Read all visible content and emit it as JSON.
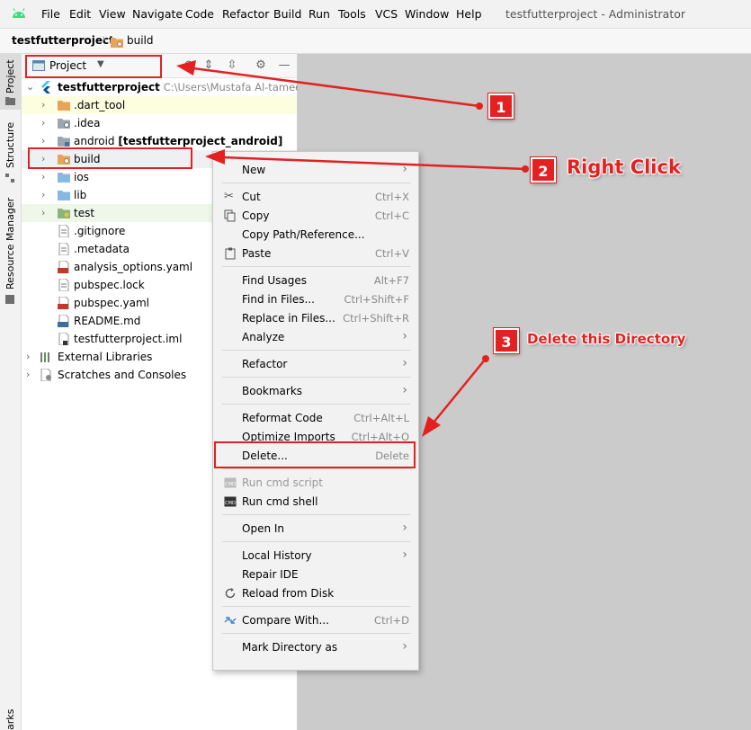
{
  "menubar": {
    "items": [
      "File",
      "Edit",
      "View",
      "Navigate",
      "Code",
      "Refactor",
      "Build",
      "Run",
      "Tools",
      "VCS",
      "Window",
      "Help"
    ],
    "window_title": "testfutterproject - Administrator"
  },
  "breadcrumb": {
    "project": "testfutterproject",
    "folder": "build"
  },
  "left_tabs": {
    "project": "Project",
    "structure": "Structure",
    "resource_manager": "Resource Manager",
    "bookmarks": "arks"
  },
  "panel": {
    "view_selector": "Project"
  },
  "tree": {
    "root": {
      "name": "testfutterproject",
      "path": "C:\\Users\\Mustafa Al-tameemi\\"
    },
    "items": [
      {
        "name": ".dart_tool",
        "icon": "folder-orange-icon"
      },
      {
        "name": ".idea",
        "icon": "folder-gear-icon"
      },
      {
        "name": "android",
        "suffix": "[testfutterproject_android]",
        "icon": "folder-module-icon"
      },
      {
        "name": "build",
        "icon": "folder-build-icon"
      },
      {
        "name": "ios",
        "icon": "folder-blue-icon"
      },
      {
        "name": "lib",
        "icon": "folder-blue-icon"
      },
      {
        "name": "test",
        "icon": "folder-test-icon"
      },
      {
        "name": ".gitignore",
        "icon": "file-icon"
      },
      {
        "name": ".metadata",
        "icon": "file-icon"
      },
      {
        "name": "analysis_options.yaml",
        "icon": "yaml-file-icon"
      },
      {
        "name": "pubspec.lock",
        "icon": "file-icon"
      },
      {
        "name": "pubspec.yaml",
        "icon": "yaml-file-icon"
      },
      {
        "name": "README.md",
        "icon": "md-file-icon"
      },
      {
        "name": "testfutterproject.iml",
        "icon": "iml-file-icon"
      }
    ],
    "external_libraries": "External Libraries",
    "scratches": "Scratches and Consoles"
  },
  "context_menu": {
    "new": "New",
    "cut": "Cut",
    "cut_sc": "Ctrl+X",
    "copy": "Copy",
    "copy_sc": "Ctrl+C",
    "copy_path": "Copy Path/Reference...",
    "paste": "Paste",
    "paste_sc": "Ctrl+V",
    "find_usages": "Find Usages",
    "find_usages_sc": "Alt+F7",
    "find_in_files": "Find in Files...",
    "find_in_files_sc": "Ctrl+Shift+F",
    "replace_in_files": "Replace in Files...",
    "replace_in_files_sc": "Ctrl+Shift+R",
    "analyze": "Analyze",
    "refactor": "Refactor",
    "bookmarks": "Bookmarks",
    "reformat_code": "Reformat Code",
    "reformat_code_sc": "Ctrl+Alt+L",
    "optimize_imports": "Optimize Imports",
    "optimize_imports_sc": "Ctrl+Alt+O",
    "delete": "Delete...",
    "delete_sc": "Delete",
    "run_cmd_script": "Run cmd script",
    "run_cmd_shell": "Run cmd shell",
    "open_in": "Open In",
    "local_history": "Local History",
    "repair_ide": "Repair IDE",
    "reload_from_disk": "Reload from Disk",
    "compare_with": "Compare With...",
    "compare_with_sc": "Ctrl+D",
    "mark_directory_as": "Mark Directory as"
  },
  "annotations": {
    "step1": "1",
    "step2": "2",
    "step2_text": "Right Click",
    "step3": "3",
    "step3_text": "Delete this Directory",
    "color": "#e32121"
  }
}
